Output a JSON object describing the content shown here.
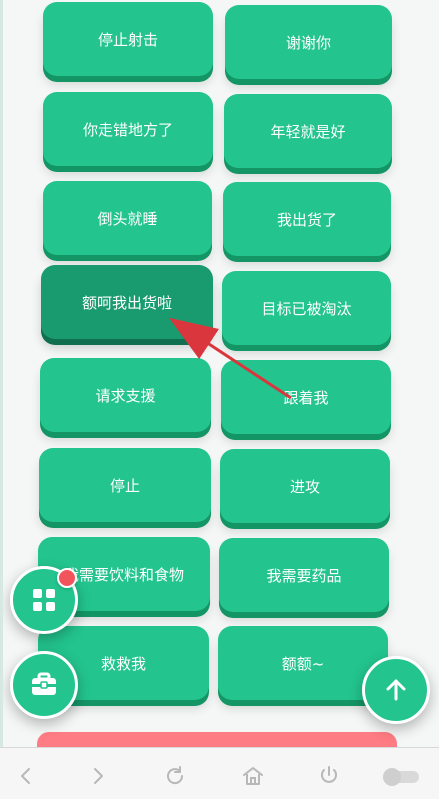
{
  "commands": [
    {
      "label": "停止射击"
    },
    {
      "label": "谢谢你"
    },
    {
      "label": "你走错地方了"
    },
    {
      "label": "年轻就是好"
    },
    {
      "label": "倒头就睡"
    },
    {
      "label": "我出货了"
    },
    {
      "label": "额呵我出货啦",
      "active": true
    },
    {
      "label": "目标已被淘汰"
    },
    {
      "label": "请求支援"
    },
    {
      "label": "跟着我"
    },
    {
      "label": "停止"
    },
    {
      "label": "进攻"
    },
    {
      "label": "我需要饮料和食物"
    },
    {
      "label": "我需要药品"
    },
    {
      "label": "救救我"
    },
    {
      "label": "额额~"
    }
  ],
  "floating_buttons": {
    "apps_icon": "grid-icon",
    "toolbox_icon": "toolbox-icon",
    "top_icon": "arrow-up-icon"
  },
  "browser_toolbar": {
    "back_icon": "back-icon",
    "forward_icon": "forward-icon",
    "refresh_icon": "refresh-icon",
    "home_icon": "home-icon",
    "power_icon": "power-icon",
    "toggle_icon": "toggle-icon"
  },
  "colors": {
    "accent": "#23c48e",
    "active": "#1a9b6f",
    "alert": "#f2545b",
    "arrow": "#d9363e"
  }
}
